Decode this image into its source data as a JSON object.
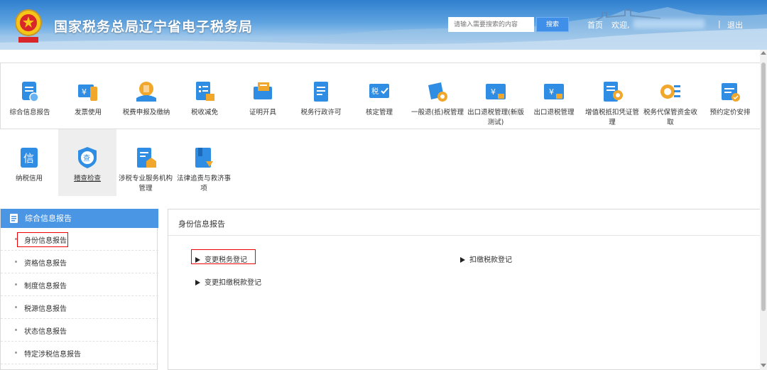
{
  "header": {
    "site_title": "国家税务总局辽宁省电子税务局",
    "search_placeholder": "请输入需要搜索的内容",
    "search_button": "搜索",
    "nav_home": "首页",
    "nav_welcome": "欢迎,",
    "nav_separator": "|",
    "nav_logout": "退出"
  },
  "modules": [
    {
      "label": "综合信息报告",
      "icon": "report-icon"
    },
    {
      "label": "发票使用",
      "icon": "invoice-icon"
    },
    {
      "label": "税费申报及缴纳",
      "icon": "tax-payment-icon"
    },
    {
      "label": "税收减免",
      "icon": "tax-reduction-icon"
    },
    {
      "label": "证明开具",
      "icon": "certificate-icon"
    },
    {
      "label": "税务行政许可",
      "icon": "permit-icon"
    },
    {
      "label": "核定管理",
      "icon": "verification-icon"
    },
    {
      "label": "一般退(抵)税管理",
      "icon": "refund-icon"
    },
    {
      "label": "出口退税管理(新版测试)",
      "icon": "export-refund-new-icon"
    },
    {
      "label": "出口退税管理",
      "icon": "export-refund-icon"
    },
    {
      "label": "增值税抵扣凭证管理",
      "icon": "vat-deduction-icon"
    },
    {
      "label": "税务代保管资金收取",
      "icon": "custody-fund-icon"
    },
    {
      "label": "预约定价安排",
      "icon": "pricing-arrangement-icon"
    },
    {
      "label": "纳税信用",
      "icon": "credit-icon"
    },
    {
      "label": "稽查检查",
      "icon": "inspection-icon"
    },
    {
      "label": "涉税专业服务机构管理",
      "icon": "service-agency-icon"
    },
    {
      "label": "法律追责与救济事项",
      "icon": "legal-remedy-icon"
    }
  ],
  "sidebar": {
    "title": "综合信息报告",
    "items": [
      {
        "label": "身份信息报告"
      },
      {
        "label": "资格信息报告"
      },
      {
        "label": "制度信息报告"
      },
      {
        "label": "税源信息报告"
      },
      {
        "label": "状态信息报告"
      },
      {
        "label": "特定涉税信息报告"
      }
    ]
  },
  "panel": {
    "title": "身份信息报告",
    "links": [
      {
        "label": "变更税务登记"
      },
      {
        "label": "扣缴税款登记"
      },
      {
        "label": "变更扣缴税款登记"
      }
    ]
  },
  "colors": {
    "accent": "#4a96e4",
    "icon_blue": "#2f8de4",
    "highlight": "#e00000"
  }
}
